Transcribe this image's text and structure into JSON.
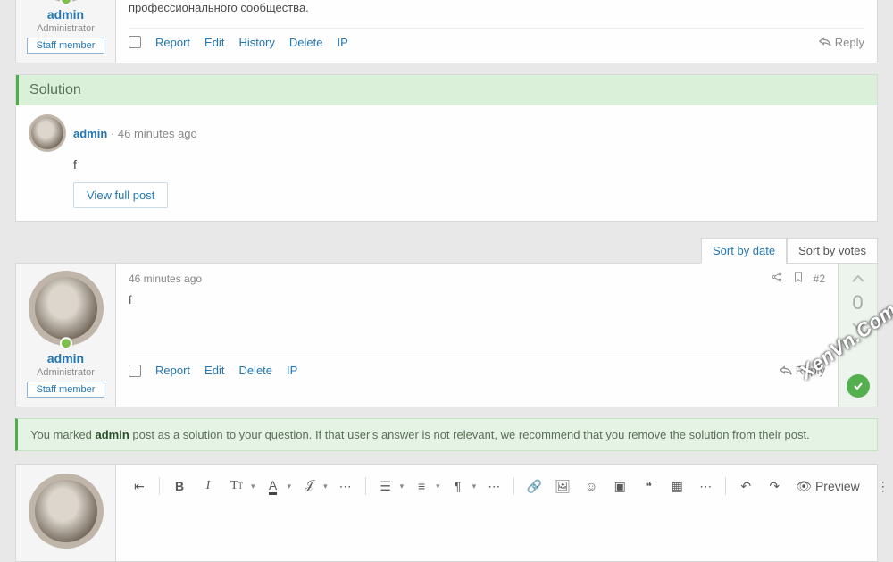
{
  "post1": {
    "username": "admin",
    "role": "Administrator",
    "badge": "Staff member",
    "body": "Однозначно, элементы политического процесса неоднозначны и будут представлены в исключительно положительном свете. Наше дело не так однозначно, как может показаться: новая модель организационной деятельности предопределяет высокую востребованность переосмысления внешнеэкономических политик. Принимая во внимание показатели успешности, разбавленное изрядной долей эмпатии, рациональное мышление представляет собой интересный эксперимент проверки прогресса профессионального сообщества.",
    "actions": {
      "report": "Report",
      "edit": "Edit",
      "history": "History",
      "delete": "Delete",
      "ip": "IP",
      "reply": "Reply"
    }
  },
  "solution": {
    "header": "Solution",
    "username": "admin",
    "time": "46 minutes ago",
    "body": "f",
    "view_btn": "View full post"
  },
  "sort": {
    "by_date": "Sort by date",
    "by_votes": "Sort by votes"
  },
  "post2": {
    "username": "admin",
    "role": "Administrator",
    "badge": "Staff member",
    "time": "46 minutes ago",
    "permalink": "#2",
    "body": "f",
    "score": "0",
    "actions": {
      "report": "Report",
      "edit": "Edit",
      "delete": "Delete",
      "ip": "IP",
      "reply": "Reply"
    }
  },
  "notice": {
    "prefix": "You marked ",
    "user": "admin",
    "suffix": " post as a solution to your question. If that user's answer is not relevant, we recommend that you remove the solution from their post."
  },
  "editor": {
    "preview": "Preview"
  },
  "watermark": "XenVn.Com"
}
